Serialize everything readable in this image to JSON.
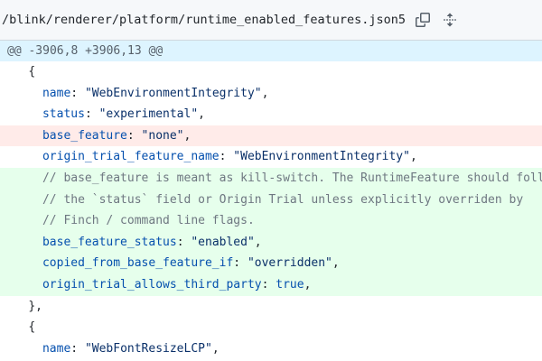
{
  "file": {
    "path": "/blink/renderer/platform/runtime_enabled_features.json5",
    "icons": [
      "copy-icon",
      "unfold-icon"
    ]
  },
  "hunk": {
    "header": "@@ -3906,8 +3906,13 @@"
  },
  "lines": [
    {
      "type": "ctx",
      "indent": "    ",
      "text": "{"
    },
    {
      "type": "ctx",
      "indent": "      ",
      "key": "name",
      "value": "\"WebEnvironmentIntegrity\"",
      "tail": ","
    },
    {
      "type": "ctx",
      "indent": "      ",
      "key": "status",
      "value": "\"experimental\"",
      "tail": ","
    },
    {
      "type": "del",
      "indent": "      ",
      "key": "base_feature",
      "value": "\"none\"",
      "tail": ","
    },
    {
      "type": "ctx",
      "indent": "      ",
      "key": "origin_trial_feature_name",
      "value": "\"WebEnvironmentIntegrity\"",
      "tail": ","
    },
    {
      "type": "add",
      "indent": "      ",
      "comment": "// base_feature is meant as kill-switch. The RuntimeFeature should follow"
    },
    {
      "type": "add",
      "indent": "      ",
      "comment": "// the `status` field or Origin Trial unless explicitly overriden by"
    },
    {
      "type": "add",
      "indent": "      ",
      "comment": "// Finch / command line flags."
    },
    {
      "type": "add",
      "indent": "      ",
      "key": "base_feature_status",
      "value": "\"enabled\"",
      "tail": ","
    },
    {
      "type": "add",
      "indent": "      ",
      "key": "copied_from_base_feature_if",
      "value": "\"overridden\"",
      "tail": ","
    },
    {
      "type": "add",
      "indent": "      ",
      "key": "origin_trial_allows_third_party",
      "keyword": "true",
      "tail": ","
    },
    {
      "type": "ctx",
      "indent": "    ",
      "text": "},"
    },
    {
      "type": "ctx",
      "indent": "    ",
      "text": "{"
    },
    {
      "type": "ctx",
      "indent": "      ",
      "key": "name",
      "value": "\"WebFontResizeLCP\"",
      "tail": ","
    }
  ],
  "colors": {
    "hunk_bg": "#ddf4ff",
    "add_bg": "#e6ffec",
    "del_bg": "#ffebe9",
    "key": "#0550ae",
    "string": "#0a3069",
    "comment": "#6e7781"
  }
}
